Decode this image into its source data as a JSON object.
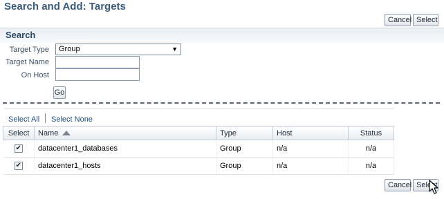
{
  "page": {
    "title": "Search and Add: Targets"
  },
  "top_buttons": {
    "cancel": "Cancel",
    "select": "Select"
  },
  "search": {
    "title": "Search",
    "target_type_label": "Target Type",
    "target_type_value": "Group",
    "target_name_label": "Target Name",
    "target_name_value": "",
    "on_host_label": "On Host",
    "on_host_value": "",
    "go_label": "Go"
  },
  "selection": {
    "select_all": "Select All",
    "select_none": "Select None"
  },
  "table": {
    "headers": {
      "select": "Select",
      "name": "Name",
      "type": "Type",
      "host": "Host",
      "status": "Status"
    },
    "rows": [
      {
        "checked": true,
        "name": "datacenter1_databases",
        "type": "Group",
        "host": "n/a",
        "status": "n/a"
      },
      {
        "checked": true,
        "name": "datacenter1_hosts",
        "type": "Group",
        "host": "n/a",
        "status": "n/a"
      }
    ]
  },
  "bottom_buttons": {
    "cancel": "Cancel",
    "select": "Select"
  },
  "icons": {
    "sort": "sort-ascending-icon",
    "checkbox": "checkbox-checked-icon",
    "cursor": "mouse-pointer-icon",
    "dropdown": "dropdown-arrow-icon"
  }
}
